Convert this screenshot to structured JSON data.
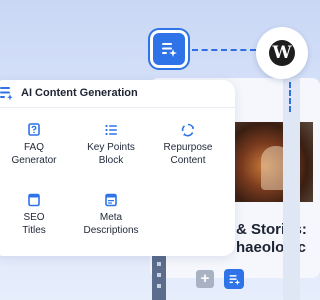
{
  "panel": {
    "title": "AI Content Generation",
    "icon": "ai-list-sparkle-icon",
    "tools": [
      {
        "label": "FAQ\nGenerator",
        "icon": "faq-icon"
      },
      {
        "label": "Key Points\nBlock",
        "icon": "list-icon"
      },
      {
        "label": "Repurpose\nContent",
        "icon": "repurpose-icon"
      },
      {
        "label": "SEO\nTitles",
        "icon": "document-icon"
      },
      {
        "label": "Meta\nDescriptions",
        "icon": "document-icon"
      }
    ]
  },
  "background": {
    "headline_line1": "& Stories:",
    "headline_line2": "haeologic"
  },
  "colors": {
    "accent": "#2f73e8",
    "panel_background": "#ffffff",
    "page_background": "#dbe5fa"
  }
}
